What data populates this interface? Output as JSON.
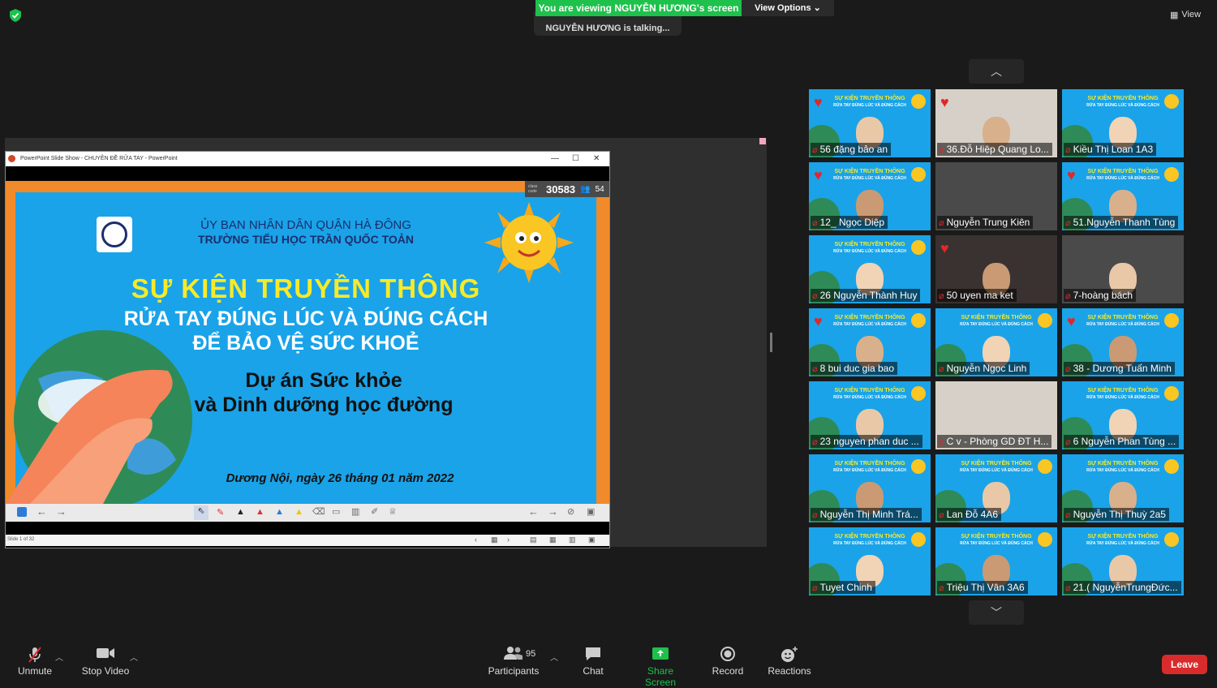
{
  "top": {
    "viewing_banner": "You are viewing NGUYỄN HƯƠNG's screen",
    "view_options": "View Options",
    "talking": "NGUYỄN HƯƠNG is talking...",
    "view_button": "View"
  },
  "powerpoint": {
    "window_title": "PowerPoint Slide Show  -  CHUYÊN ĐỀ RỬA TAY  -  PowerPoint",
    "class_code_label": "class code",
    "class_code": "30583",
    "viewer_count": "54",
    "slide_counter": "Slide 1 of 32",
    "slide": {
      "org_line1": "ỦY BAN NHÂN DÂN QUẬN HÀ ĐÔNG",
      "org_line2": "TRƯỜNG TIỂU HỌC TRẦN QUỐC TOẢN",
      "event_title": "SỰ KIỆN TRUYỀN THÔNG",
      "subtitle1": "RỬA TAY ĐÚNG LÚC VÀ ĐÚNG CÁCH",
      "subtitle2": "ĐỂ BẢO VỆ SỨC KHOẺ",
      "project1": "Dự án Sức khỏe",
      "project2": "và Dinh dưỡng học đường",
      "date": "Dương Nội, ngày 26 tháng 01 năm 2022"
    }
  },
  "tiles": [
    {
      "name": "56 đặng  bảo an",
      "heart": true,
      "slide": true
    },
    {
      "name": "36.Đỗ Hiệp Quang Lo...",
      "heart": true,
      "slide": false
    },
    {
      "name": "Kiều Thị Loan 1A3",
      "heart": false,
      "slide": true
    },
    {
      "name": "12_ Ngọc Diệp",
      "heart": true,
      "slide": true
    },
    {
      "name": "Nguyễn Trung Kiên",
      "heart": false,
      "slide": false
    },
    {
      "name": "51.Nguyễn Thanh Tùng",
      "heart": true,
      "slide": true
    },
    {
      "name": "26 Nguyễn Thành Huy",
      "heart": false,
      "slide": true
    },
    {
      "name": "50 uyen ma ket",
      "heart": true,
      "slide": false
    },
    {
      "name": "7-hoàng bách",
      "heart": false,
      "slide": false
    },
    {
      "name": "8 bui duc gia bao",
      "heart": true,
      "slide": true
    },
    {
      "name": "Nguyễn Ngọc Linh",
      "heart": false,
      "slide": true
    },
    {
      "name": "38 - Dương Tuấn Minh",
      "heart": true,
      "slide": true
    },
    {
      "name": "23 nguyen phan duc ...",
      "heart": false,
      "slide": true
    },
    {
      "name": "C v - Phòng GD ĐT H...",
      "heart": false,
      "slide": false
    },
    {
      "name": "6 Nguyễn Phan Tùng ...",
      "heart": false,
      "slide": true
    },
    {
      "name": "Nguyễn Thị Minh Trá...",
      "heart": false,
      "slide": true
    },
    {
      "name": "Lan Đỗ 4A6",
      "heart": false,
      "slide": true
    },
    {
      "name": "Nguyễn Thị Thuỳ 2a5",
      "heart": false,
      "slide": true
    },
    {
      "name": "Tuyet Chinh",
      "heart": false,
      "slide": true
    },
    {
      "name": "Triệu Thị Vân 3A6",
      "heart": false,
      "slide": true
    },
    {
      "name": "21.( NguyễnTrungĐức...",
      "heart": false,
      "slide": true
    }
  ],
  "tile_slide_title": "SỰ KIỆN TRUYỀN THÔNG",
  "tile_slide_sub": "RỬA TAY ĐÚNG LÚC VÀ ĐÚNG CÁCH",
  "toolbar": {
    "unmute": "Unmute",
    "stop_video": "Stop Video",
    "participants": "Participants",
    "participants_count": "95",
    "chat": "Chat",
    "share_screen": "Share Screen",
    "record": "Record",
    "reactions": "Reactions",
    "leave": "Leave"
  },
  "colors": {
    "banner_green": "#1ec14b",
    "leave_red": "#d92b2b",
    "slide_blue": "#1aa3e8",
    "slide_orange": "#f08a2a",
    "title_yellow": "#f7ea28"
  }
}
